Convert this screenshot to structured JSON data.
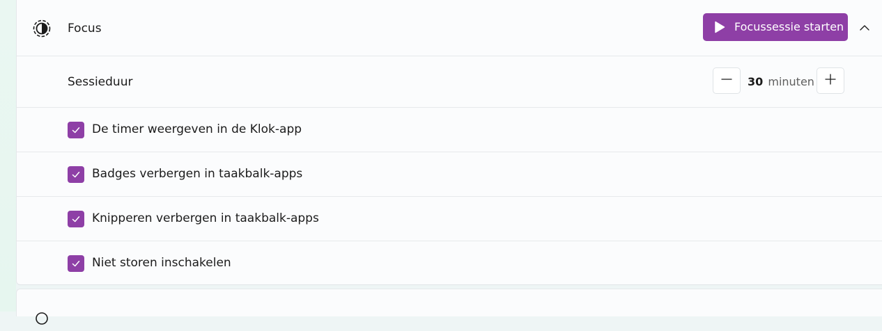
{
  "focus": {
    "title": "Focus",
    "icon": "focus-timer-icon",
    "start_button": {
      "label": "Focussessie starten",
      "icon": "play-icon"
    },
    "collapse_icon": "chevron-up-icon",
    "accent_color": "#8e3fa6"
  },
  "session": {
    "label": "Sessieduur",
    "value": "30",
    "unit": "minuten",
    "decrease_icon": "minus-icon",
    "increase_icon": "plus-icon"
  },
  "options": [
    {
      "label": "De timer weergeven in de Klok-app",
      "checked": true
    },
    {
      "label": "Badges verbergen in taakbalk-apps",
      "checked": true
    },
    {
      "label": "Knipperen verbergen in taakbalk-apps",
      "checked": true
    },
    {
      "label": "Niet storen inschakelen",
      "checked": true
    }
  ]
}
